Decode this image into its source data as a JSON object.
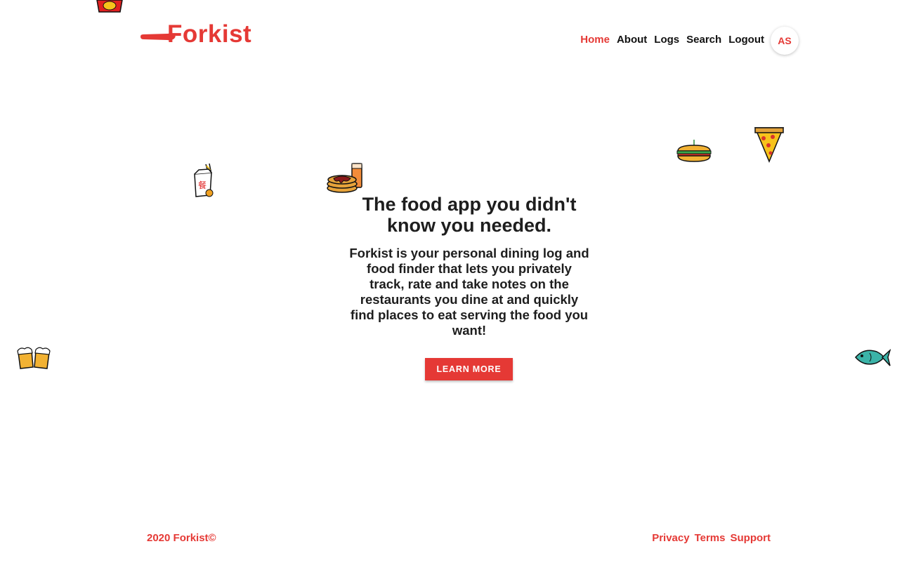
{
  "brand": {
    "name": "Forkist",
    "color": "#e53935"
  },
  "nav": {
    "items": [
      {
        "label": "Home",
        "active": true
      },
      {
        "label": "About",
        "active": false
      },
      {
        "label": "Logs",
        "active": false
      },
      {
        "label": "Search",
        "active": false
      },
      {
        "label": "Logout",
        "active": false
      }
    ],
    "avatar_initials": "AS"
  },
  "hero": {
    "headline": "The food app you didn't know you needed.",
    "description": "Forkist is your personal dining log and food finder that lets you privately track, rate and take notes on the restaurants you dine at and quickly find places to eat serving the food you want!",
    "cta_label": "LEARN MORE"
  },
  "footer": {
    "copyright": "2020 Forkist©",
    "links": [
      "Privacy",
      "Terms",
      "Support"
    ]
  },
  "decorations": [
    "fries-icon",
    "takeout-box-icon",
    "pancakes-icon",
    "sandwich-icon",
    "pizza-slice-icon",
    "beer-mugs-icon",
    "fish-icon"
  ]
}
